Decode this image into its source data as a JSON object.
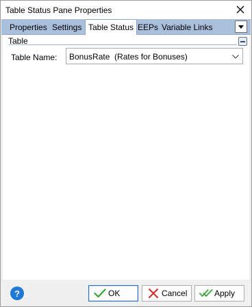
{
  "window": {
    "title": "Table Status Pane Properties"
  },
  "tabs": [
    {
      "label": "Properties",
      "active": false
    },
    {
      "label": "Settings",
      "active": false
    },
    {
      "label": "Table Status",
      "active": true
    },
    {
      "label": "EEPs",
      "active": false
    },
    {
      "label": "Variable Links",
      "active": false
    }
  ],
  "group": {
    "title": "Table"
  },
  "table_name": {
    "label": "Table Name:",
    "value": "BonusRate  (Rates for Bonuses)"
  },
  "footer": {
    "help_symbol": "?",
    "ok_label": "OK",
    "cancel_label": "Cancel",
    "apply_label": "Apply"
  },
  "colors": {
    "tabstrip": "#a9bfdc",
    "help": "#1e78d7",
    "ok_check": "#2e9e2e",
    "cancel_x": "#d22b2b"
  }
}
